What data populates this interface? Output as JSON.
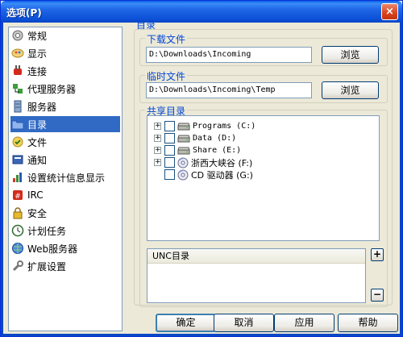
{
  "window": {
    "title": "选项(P)",
    "close": "×"
  },
  "sidebar": {
    "items": [
      {
        "label": "常规",
        "icon": "gear-icon"
      },
      {
        "label": "显示",
        "icon": "display-icon"
      },
      {
        "label": "连接",
        "icon": "plug-icon"
      },
      {
        "label": "代理服务器",
        "icon": "proxy-icon"
      },
      {
        "label": "服务器",
        "icon": "server-icon"
      },
      {
        "label": "目录",
        "icon": "folder-icon",
        "selected": true
      },
      {
        "label": "文件",
        "icon": "file-icon"
      },
      {
        "label": "通知",
        "icon": "notify-icon"
      },
      {
        "label": "设置统计信息显示",
        "icon": "stats-icon"
      },
      {
        "label": "IRC",
        "icon": "irc-icon"
      },
      {
        "label": "安全",
        "icon": "lock-icon"
      },
      {
        "label": "计划任务",
        "icon": "clock-icon"
      },
      {
        "label": "Web服务器",
        "icon": "globe-icon"
      },
      {
        "label": "扩展设置",
        "icon": "wrench-icon"
      }
    ]
  },
  "main": {
    "section_title": "目录",
    "download": {
      "label": "下载文件",
      "path": "D:\\Downloads\\Incoming",
      "browse": "浏览"
    },
    "temp": {
      "label": "临时文件",
      "path": "D:\\Downloads\\Incoming\\Temp",
      "browse": "浏览"
    },
    "shared": {
      "label": "共享目录",
      "tree": [
        {
          "label": "Programs (C:)",
          "expand": "+",
          "cjk": false
        },
        {
          "label": "Data (D:)",
          "expand": "+",
          "cjk": false
        },
        {
          "label": "Share (E:)",
          "expand": "+",
          "cjk": false
        },
        {
          "label": "浙西大峡谷 (F:)",
          "expand": "+",
          "cjk": true,
          "cd": true
        },
        {
          "label": "CD 驱动器 (G:)",
          "expand": "",
          "cjk": true,
          "cd": true
        }
      ]
    },
    "unc": {
      "header": "UNC目录",
      "add": "+",
      "remove": "−"
    }
  },
  "footer": {
    "ok": "确定",
    "cancel": "取消",
    "apply": "应用",
    "help": "帮助"
  }
}
